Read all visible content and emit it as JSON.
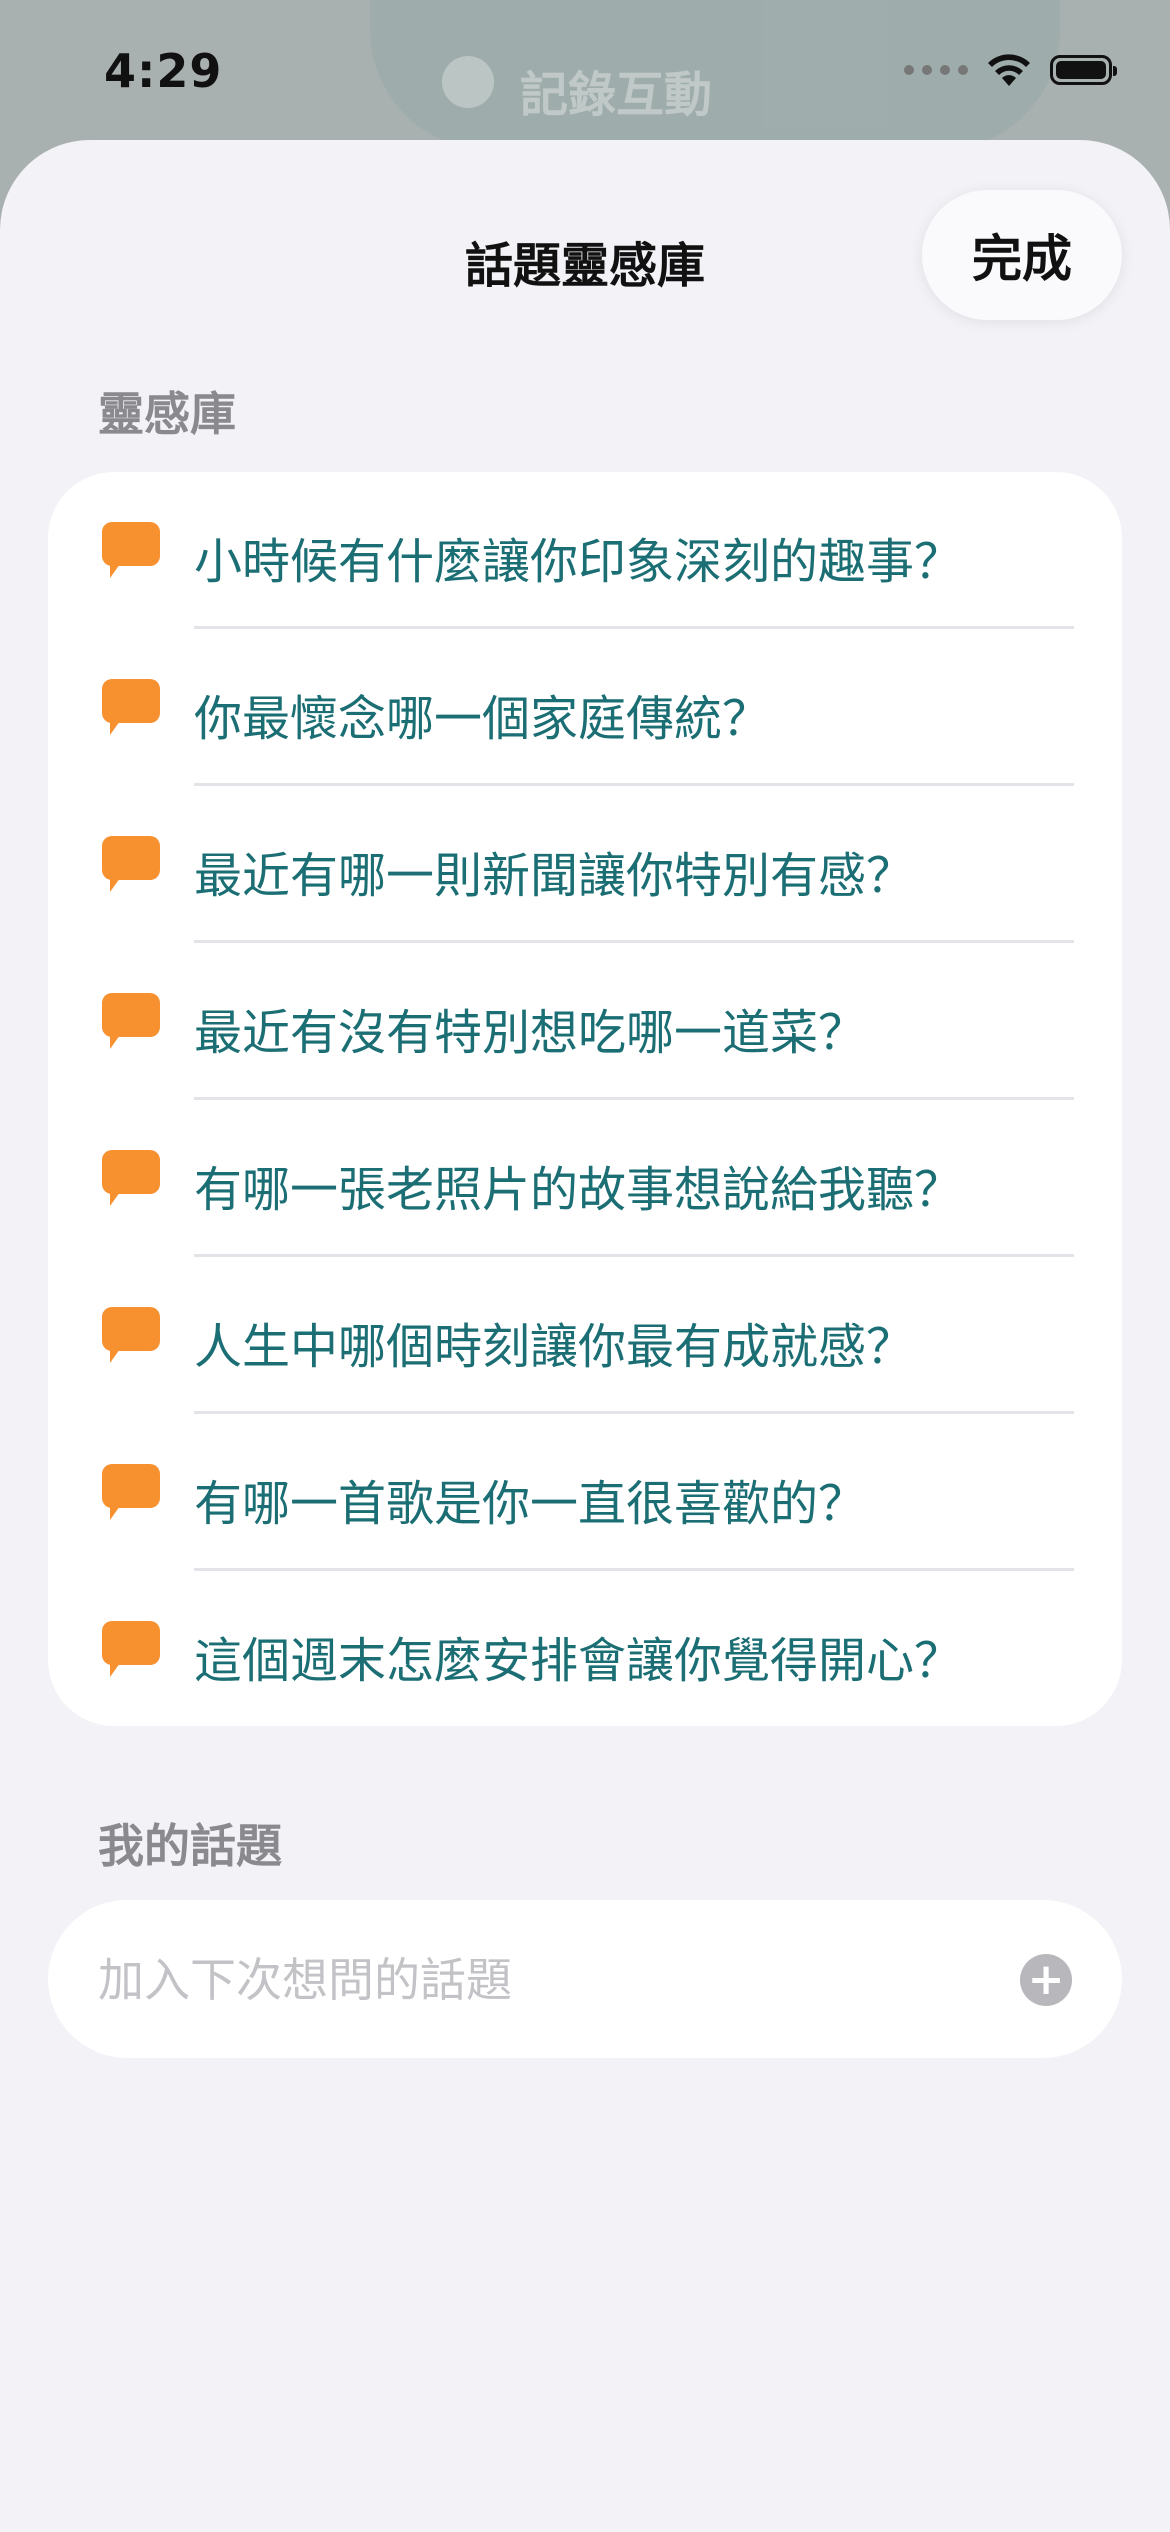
{
  "status_bar": {
    "time": "4:29",
    "backdrop_label": "記錄互動"
  },
  "sheet": {
    "title": "話題靈感庫",
    "done_label": "完成"
  },
  "library": {
    "heading": "靈感庫",
    "icon": "speech-bubble-icon",
    "icon_color": "#f7902e",
    "text_color": "#1b6e73",
    "items": [
      "小時候有什麼讓你印象深刻的趣事？",
      "你最懷念哪一個家庭傳統？",
      "最近有哪一則新聞讓你特別有感？",
      "最近有沒有特別想吃哪一道菜？",
      "有哪一張老照片的故事想說給我聽？",
      "人生中哪個時刻讓你最有成就感？",
      "有哪一首歌是你一直很喜歡的？",
      "這個週末怎麼安排會讓你覺得開心？"
    ]
  },
  "my_topics": {
    "heading": "我的話題",
    "input_value": "",
    "placeholder": "加入下次想問的話題",
    "add_icon": "plus-circle-icon"
  }
}
